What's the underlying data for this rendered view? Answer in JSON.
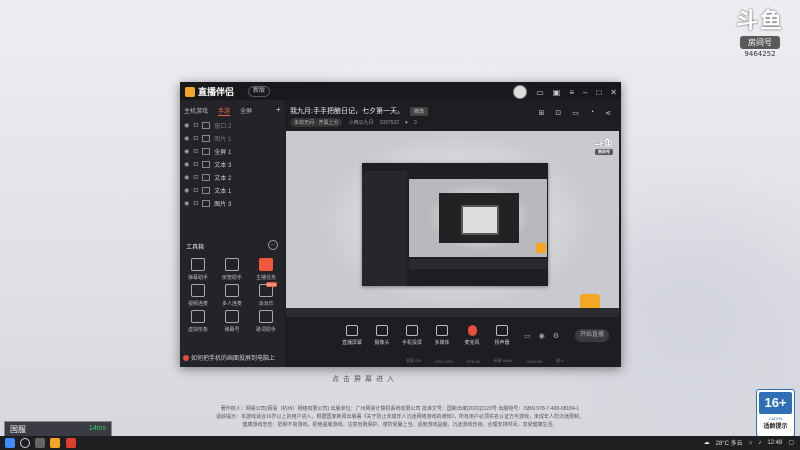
{
  "watermark": {
    "brand": "斗鱼",
    "room_label": "房间号",
    "room_number": "9464252"
  },
  "app": {
    "name": "直播伴侣",
    "version_label": "新版",
    "sidebar": {
      "tabs": [
        "主机游戏",
        "手游",
        "全屏",
        "+"
      ],
      "active_tab": 1,
      "scenes": [
        {
          "label": "窗口 2",
          "dim": true
        },
        {
          "label": "图片 1",
          "dim": true
        },
        {
          "label": "全屏 1",
          "dim": false
        },
        {
          "label": "文本 3",
          "dim": false
        },
        {
          "label": "文本 2",
          "dim": false
        },
        {
          "label": "文本 1",
          "dim": false
        },
        {
          "label": "图片 3",
          "dim": false
        }
      ],
      "tools_title": "工具箱",
      "tools_more": "⋯",
      "tools": [
        {
          "label": "弹幕助手",
          "hot": false,
          "badge": ""
        },
        {
          "label": "房管助手",
          "hot": false,
          "badge": ""
        },
        {
          "label": "主播任务",
          "hot": true,
          "badge": ""
        },
        {
          "label": "视频连麦",
          "hot": false,
          "badge": ""
        },
        {
          "label": "多人连麦",
          "hot": false,
          "badge": ""
        },
        {
          "label": "派派乐",
          "hot": false,
          "badge": "NEW"
        },
        {
          "label": "虚拟形象",
          "hot": false,
          "badge": ""
        },
        {
          "label": "弹幕号",
          "hot": false,
          "badge": ""
        },
        {
          "label": "歌词助手",
          "hot": false,
          "badge": ""
        }
      ],
      "notice": "如何把手机的画面投屏到电脑上"
    },
    "stream": {
      "title": "我九月:手手把酿日记，七夕第一天。",
      "tag": "修改",
      "category": "永劫无间 · 开黑上分",
      "streamer": "小西瓜九月",
      "room_id": "1097522",
      "viewers": "0"
    },
    "controls": [
      {
        "label": "直播屏幕",
        "mic": false
      },
      {
        "label": "摄像头",
        "mic": false
      },
      {
        "label": "手机投屏",
        "mic": false
      },
      {
        "label": "多媒体",
        "mic": false
      },
      {
        "label": "麦克风",
        "mic": true
      },
      {
        "label": "扬声器",
        "mic": false
      }
    ],
    "go_live": "开始直播",
    "statusbar": [
      "丢帧 0%",
      "CPU 12%",
      "FPS 60",
      "码率 0kb/s",
      "00:00:00",
      "帧 0"
    ],
    "preview_watermark": {
      "brand": "斗鱼",
      "room": "房间号"
    }
  },
  "click_hint": "点击屏幕进入",
  "legal": {
    "line1": "著作权人：网易公司(网易（杭州）网络有限公司) 出版单位：广州网易计算机系统有限公司 批准文号：国新出审[2020]2123号 出版物号：ISBN 978-7-498-08184-1",
    "line2": "适龄提示：本游戏适合16岁以上的用户进入，根据国家新闻出版署《关于防止未成年人沉迷网络游戏的通知》，所有用户必须实名认证方可游戏，未成年人防沉迷限制。",
    "line3": "健康游戏忠告：抵制不良游戏，拒绝盗版游戏。注意自我保护，谨防受骗上当。适度游戏益脑，沉迷游戏伤身。合理安排时间，享受健康生活。"
  },
  "age_rating": {
    "number": "16+",
    "org": "CADPA",
    "text": "适龄提示"
  },
  "ping": {
    "label": "国服",
    "value": "14ms"
  },
  "taskbar": {
    "weather": "28°C 多云",
    "time": "12:48"
  }
}
